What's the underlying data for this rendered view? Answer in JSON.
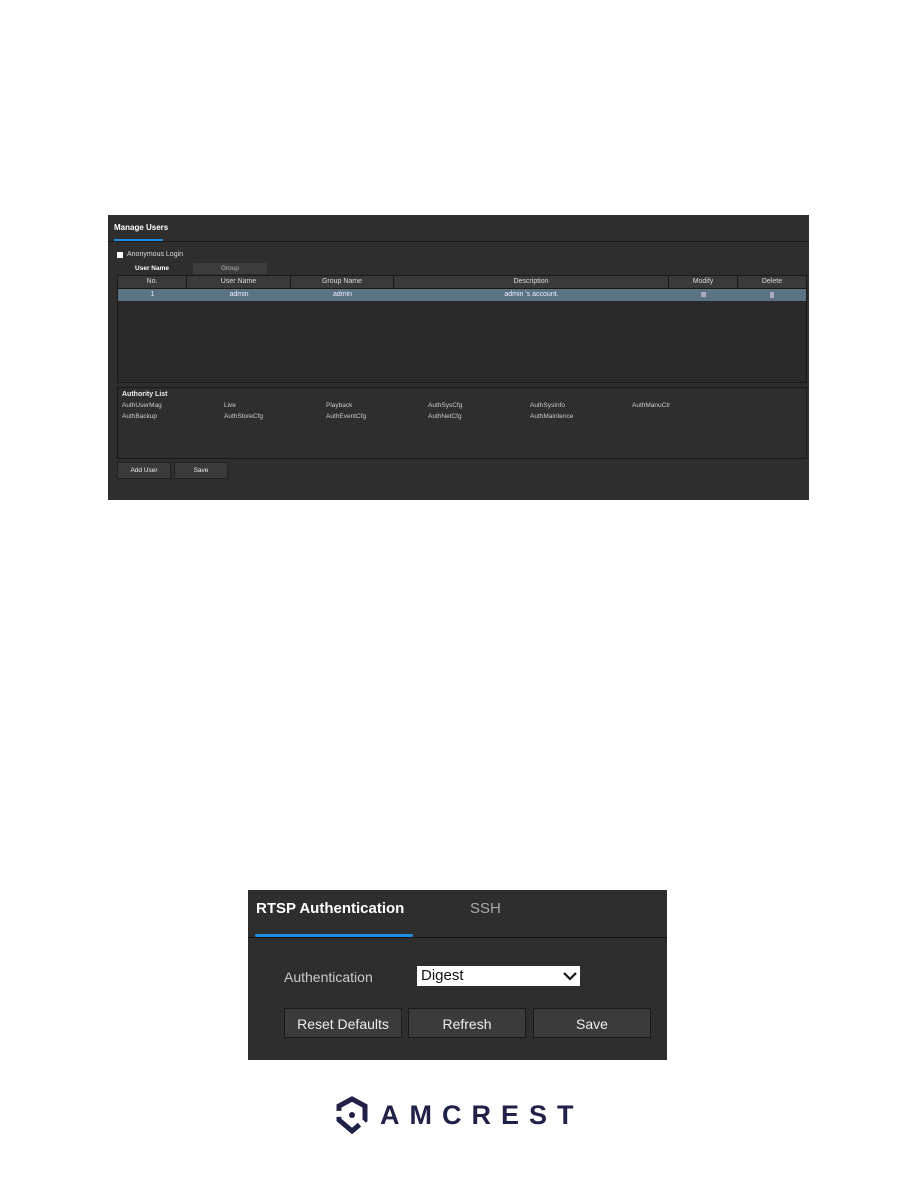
{
  "manage_users": {
    "title": "Manage Users",
    "anonymous_login": "Anonymous Login",
    "subtabs": [
      "User Name",
      "Group"
    ],
    "columns": [
      "No.",
      "User Name",
      "Group Name",
      "Description",
      "Modify",
      "Delete"
    ],
    "rows": [
      {
        "no": "1",
        "user": "admin",
        "group": "admin",
        "description": "admin 's account."
      }
    ],
    "authority_title": "Authority List",
    "authorities": [
      "AuthUserMag",
      "Live",
      "Playback",
      "AuthSysCfg",
      "AuthSysInfo",
      "AuthManuCtr",
      "AuthBackup",
      "AuthStoreCfg",
      "AuthEventCfg",
      "AuthNetCfg",
      "AuthMaintence"
    ],
    "buttons": [
      "Add User",
      "Save"
    ]
  },
  "rtsp": {
    "tabs": [
      "RTSP Authentication",
      "SSH"
    ],
    "auth_label": "Authentication",
    "auth_value": "Digest",
    "buttons": [
      "Reset Defaults",
      "Refresh",
      "Save"
    ]
  },
  "logo": {
    "text": "AMCREST",
    "color": "#1f2147"
  },
  "colors": {
    "accent": "#1f8ee0",
    "selected_row": "#5b7382",
    "panel": "#2e2e2e"
  }
}
